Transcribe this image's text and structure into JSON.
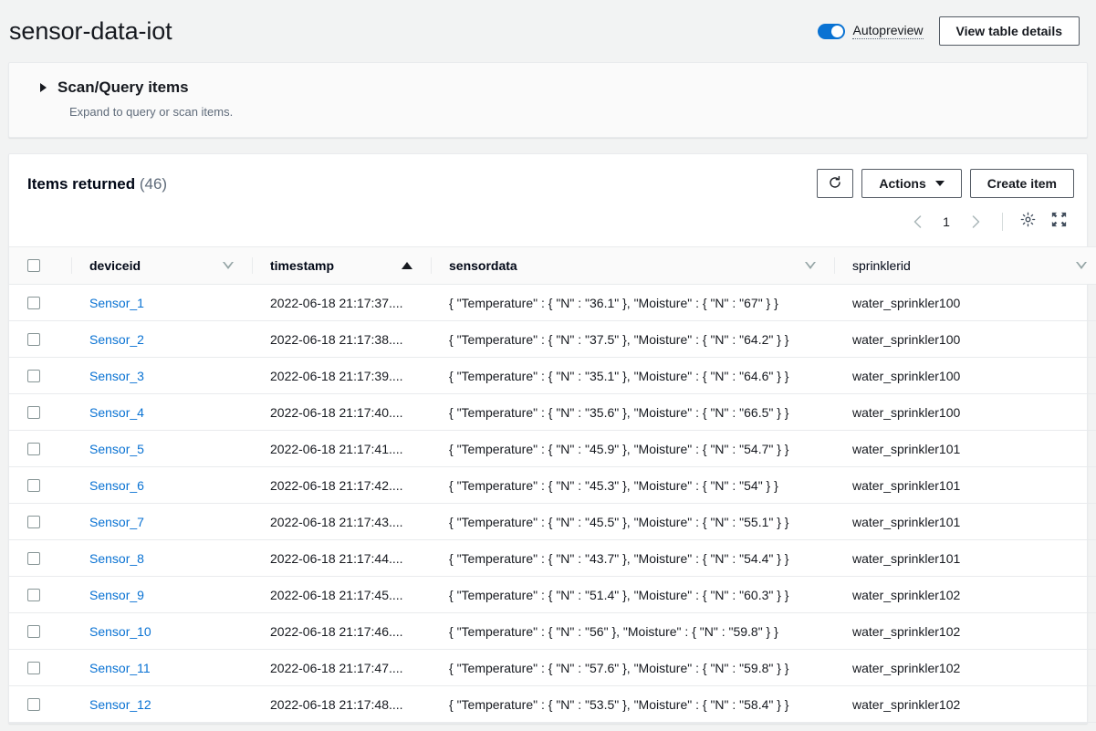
{
  "header": {
    "title": "sensor-data-iot",
    "autopreview_label": "Autopreview",
    "view_table_details_label": "View table details"
  },
  "scan_query": {
    "title": "Scan/Query items",
    "subtitle": "Expand to query or scan items."
  },
  "items_section": {
    "title": "Items returned",
    "count": "(46)",
    "refresh_icon": "refresh-icon",
    "actions_label": "Actions",
    "create_item_label": "Create item",
    "pagination": {
      "prev_icon": "chevron-left-icon",
      "current_page": "1",
      "next_icon": "chevron-right-icon",
      "settings_icon": "gear-icon",
      "fullscreen_icon": "expand-icon"
    }
  },
  "table": {
    "columns": [
      {
        "key": "deviceid",
        "label": "deviceid",
        "sort": "none"
      },
      {
        "key": "timestamp",
        "label": "timestamp",
        "sort": "asc"
      },
      {
        "key": "sensordata",
        "label": "sensordata",
        "sort": "none"
      },
      {
        "key": "sprinklerid",
        "label": "sprinklerid",
        "sort": "none"
      }
    ],
    "rows": [
      {
        "deviceid": "Sensor_1",
        "timestamp": "2022-06-18 21:17:37....",
        "sensordata": "{ \"Temperature\" : { \"N\" : \"36.1\" }, \"Moisture\" : { \"N\" : \"67\" } }",
        "sprinklerid": "water_sprinkler100"
      },
      {
        "deviceid": "Sensor_2",
        "timestamp": "2022-06-18 21:17:38....",
        "sensordata": "{ \"Temperature\" : { \"N\" : \"37.5\" }, \"Moisture\" : { \"N\" : \"64.2\" } }",
        "sprinklerid": "water_sprinkler100"
      },
      {
        "deviceid": "Sensor_3",
        "timestamp": "2022-06-18 21:17:39....",
        "sensordata": "{ \"Temperature\" : { \"N\" : \"35.1\" }, \"Moisture\" : { \"N\" : \"64.6\" } }",
        "sprinklerid": "water_sprinkler100"
      },
      {
        "deviceid": "Sensor_4",
        "timestamp": "2022-06-18 21:17:40....",
        "sensordata": "{ \"Temperature\" : { \"N\" : \"35.6\" }, \"Moisture\" : { \"N\" : \"66.5\" } }",
        "sprinklerid": "water_sprinkler100"
      },
      {
        "deviceid": "Sensor_5",
        "timestamp": "2022-06-18 21:17:41....",
        "sensordata": "{ \"Temperature\" : { \"N\" : \"45.9\" }, \"Moisture\" : { \"N\" : \"54.7\" } }",
        "sprinklerid": "water_sprinkler101"
      },
      {
        "deviceid": "Sensor_6",
        "timestamp": "2022-06-18 21:17:42....",
        "sensordata": "{ \"Temperature\" : { \"N\" : \"45.3\" }, \"Moisture\" : { \"N\" : \"54\" } }",
        "sprinklerid": "water_sprinkler101"
      },
      {
        "deviceid": "Sensor_7",
        "timestamp": "2022-06-18 21:17:43....",
        "sensordata": "{ \"Temperature\" : { \"N\" : \"45.5\" }, \"Moisture\" : { \"N\" : \"55.1\" } }",
        "sprinklerid": "water_sprinkler101"
      },
      {
        "deviceid": "Sensor_8",
        "timestamp": "2022-06-18 21:17:44....",
        "sensordata": "{ \"Temperature\" : { \"N\" : \"43.7\" }, \"Moisture\" : { \"N\" : \"54.4\" } }",
        "sprinklerid": "water_sprinkler101"
      },
      {
        "deviceid": "Sensor_9",
        "timestamp": "2022-06-18 21:17:45....",
        "sensordata": "{ \"Temperature\" : { \"N\" : \"51.4\" }, \"Moisture\" : { \"N\" : \"60.3\" } }",
        "sprinklerid": "water_sprinkler102"
      },
      {
        "deviceid": "Sensor_10",
        "timestamp": "2022-06-18 21:17:46....",
        "sensordata": "{ \"Temperature\" : { \"N\" : \"56\" }, \"Moisture\" : { \"N\" : \"59.8\" } }",
        "sprinklerid": "water_sprinkler102"
      },
      {
        "deviceid": "Sensor_11",
        "timestamp": "2022-06-18 21:17:47....",
        "sensordata": "{ \"Temperature\" : { \"N\" : \"57.6\" }, \"Moisture\" : { \"N\" : \"59.8\" } }",
        "sprinklerid": "water_sprinkler102"
      },
      {
        "deviceid": "Sensor_12",
        "timestamp": "2022-06-18 21:17:48....",
        "sensordata": "{ \"Temperature\" : { \"N\" : \"53.5\" }, \"Moisture\" : { \"N\" : \"58.4\" } }",
        "sprinklerid": "water_sprinkler102"
      }
    ]
  },
  "colors": {
    "accent": "#0972d3",
    "page_background": "#f2f3f3",
    "border": "#e9ebed",
    "text": "#16191f",
    "muted_text": "#5f6b7a"
  }
}
